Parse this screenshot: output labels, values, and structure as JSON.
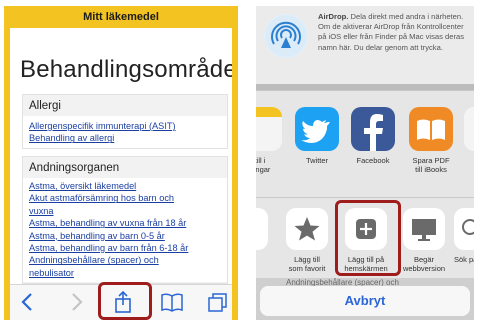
{
  "left_screen": {
    "header_title": "Mitt läkemedel",
    "page_title": "Behandlingsområden",
    "sections": [
      {
        "heading": "Allergi",
        "links": [
          "Allergenspecifik immunterapi (ASIT)",
          "Behandling av allergi"
        ]
      },
      {
        "heading": "Andningsorganen",
        "links": [
          "Astma, översikt läkemedel",
          "Akut astmaförsämring hos barn och",
          "vuxna",
          "Astma, behandling av vuxna från 18 år",
          "Astma, behandling av barn 0-5 år",
          "Astma, behandling av barn från 6-18 år",
          "Andningsbehållare (spacer) och",
          "nebulisator"
        ]
      }
    ],
    "toolbar": {
      "back_icon": "chevron-left-icon",
      "forward_icon": "chevron-right-icon",
      "share_icon": "share-icon",
      "bookmarks_icon": "book-icon",
      "tabs_icon": "tabs-icon"
    }
  },
  "right_screen": {
    "airdrop": {
      "title": "AirDrop.",
      "text": "Dela direkt med andra i närheten. Om de aktiverar AirDrop från Kontrollcenter på iOS eller från Finder på Mac visas deras namn här. Du delar genom att trycka."
    },
    "apps": [
      {
        "label": "till i",
        "label2": "ningar",
        "icon": "notes-icon",
        "color": "#f2f2f2"
      },
      {
        "label": "Twitter",
        "label2": "",
        "icon": "twitter-icon",
        "color": "#1da1f2"
      },
      {
        "label": "Facebook",
        "label2": "",
        "icon": "facebook-icon",
        "color": "#3b5998"
      },
      {
        "label": "Spara PDF",
        "label2": "till iBooks",
        "icon": "ibooks-icon",
        "color": "#f08a24"
      }
    ],
    "actions": [
      {
        "label": "",
        "label2": "",
        "icon": "partial-icon"
      },
      {
        "label": "Lägg till",
        "label2": "som favorit",
        "icon": "star-icon"
      },
      {
        "label": "Lägg till på",
        "label2": "hemskärmen",
        "icon": "add-to-home-icon"
      },
      {
        "label": "Begär",
        "label2": "webbversion",
        "icon": "desktop-icon"
      },
      {
        "label": "Sök på",
        "label2": "",
        "icon": "search-icon"
      }
    ],
    "behind_text": "Andningsbehållare (spacer) och",
    "cancel_label": "Avbryt"
  },
  "colors": {
    "header_yellow": "#f3c322",
    "link_blue": "#1a3fa3",
    "highlight_red": "#9e1c1c",
    "ios_blue": "#2b66d6"
  }
}
